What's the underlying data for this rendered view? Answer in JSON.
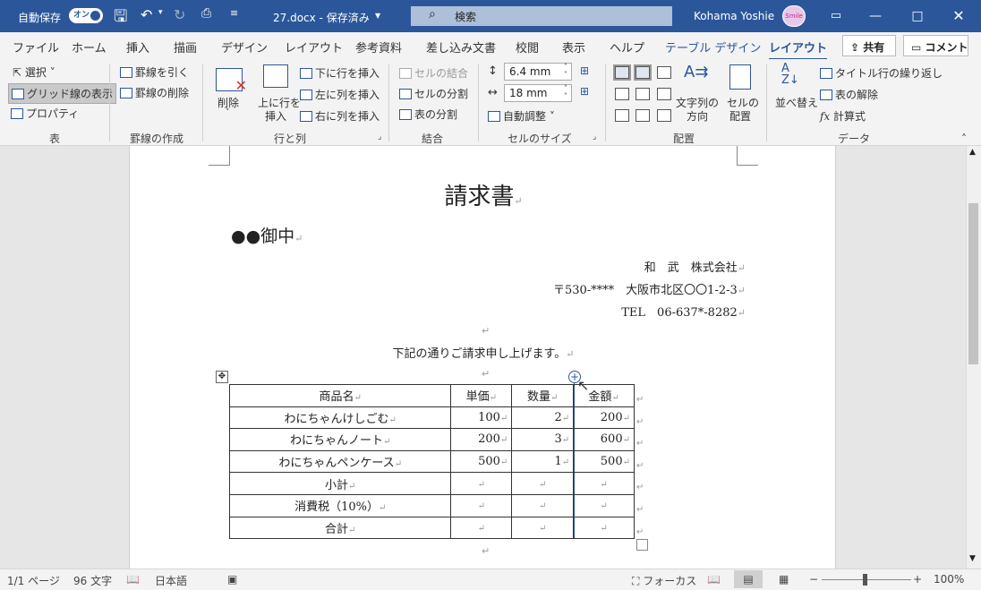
{
  "titlebar": {
    "autosave_label": "自動保存",
    "autosave_state": "オン",
    "doc_title": "27.docx - 保存済み",
    "search_placeholder": "検索",
    "user_name": "Kohama Yoshie"
  },
  "tabs": [
    "ファイル",
    "ホーム",
    "挿入",
    "描画",
    "デザイン",
    "レイアウト",
    "参考資料",
    "差し込み文書",
    "校閲",
    "表示",
    "ヘルプ",
    "テーブル デザイン",
    "レイアウト"
  ],
  "share_label": "共有",
  "comment_label": "コメント",
  "ribbon": {
    "table": {
      "select": "選択",
      "gridlines": "グリッド線の表示",
      "properties": "プロパティ",
      "group": "表"
    },
    "draw": {
      "draw_border": "罫線を引く",
      "erase": "罫線の削除",
      "group": "罫線の作成"
    },
    "rows": {
      "delete": "削除",
      "insert_above_1": "上に行を",
      "insert_above_2": "挿入",
      "insert_below": "下に行を挿入",
      "insert_left": "左に列を挿入",
      "insert_right": "右に列を挿入",
      "group": "行と列"
    },
    "merge": {
      "merge_cells": "セルの結合",
      "split_cells": "セルの分割",
      "split_table": "表の分割",
      "group": "結合"
    },
    "cellsize": {
      "height": "6.4 mm",
      "width": "18 mm",
      "autofit": "自動調整",
      "group": "セルのサイズ"
    },
    "alignment": {
      "direction_1": "文字列の",
      "direction_2": "方向",
      "margins_1": "セルの",
      "margins_2": "配置",
      "group": "配置"
    },
    "data": {
      "sort_1": "並べ替え",
      "repeat_header": "タイトル行の繰り返し",
      "convert": "表の解除",
      "formula": "計算式",
      "group": "データ"
    }
  },
  "document": {
    "title": "請求書",
    "recipient": "●●御中",
    "company": "和　武　株式会社",
    "address": "〒530-****　大阪市北区〇〇1-2-3",
    "tel": "TEL　06-637*-8282",
    "intro": "下記の通りご請求申し上げます。",
    "return_mark": "↵",
    "table": {
      "headers": [
        "商品名",
        "単価",
        "数量",
        "金額"
      ],
      "rows": [
        [
          "わにちゃんけしごむ",
          "100",
          "2",
          "200"
        ],
        [
          "わにちゃんノート",
          "200",
          "3",
          "600"
        ],
        [
          "わにちゃんペンケース",
          "500",
          "1",
          "500"
        ],
        [
          "小計",
          "",
          "",
          ""
        ],
        [
          "消費税（10%）",
          "",
          "",
          ""
        ],
        [
          "合計",
          "",
          "",
          ""
        ]
      ]
    }
  },
  "statusbar": {
    "page": "1/1 ページ",
    "words": "96 文字",
    "language": "日本語",
    "focus": "フォーカス",
    "zoom": "100%"
  }
}
